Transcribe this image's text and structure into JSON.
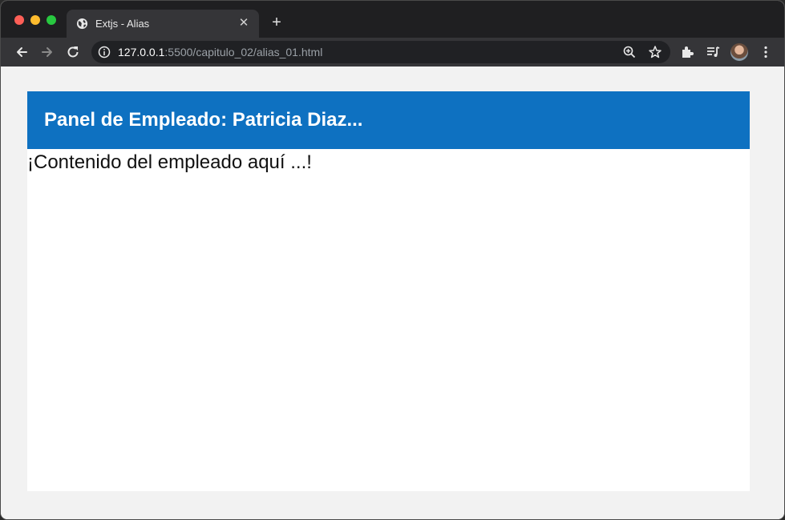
{
  "browser": {
    "tab": {
      "title": "Extjs - Alias",
      "favicon": "globe-icon",
      "close_glyph": "✕"
    },
    "new_tab_glyph": "+",
    "omnibox": {
      "url_host": "127.0.0.1",
      "url_rest": ":5500/capitulo_02/alias_01.html"
    },
    "icons": [
      "back-icon",
      "forward-icon",
      "reload-icon",
      "info-icon",
      "zoom-icon",
      "star-icon",
      "extensions-icon",
      "media-icon",
      "avatar",
      "menu-icon"
    ]
  },
  "page": {
    "panel": {
      "title": "Panel de Empleado: Patricia Diaz...",
      "body": "¡Contenido del empleado aquí ...!"
    }
  },
  "colors": {
    "panel_header": "#0e71c1",
    "page_background": "#f2f2f2",
    "panel_background": "#ffffff",
    "chrome_tabstrip": "#1f1f21",
    "chrome_toolbar": "#353538"
  }
}
